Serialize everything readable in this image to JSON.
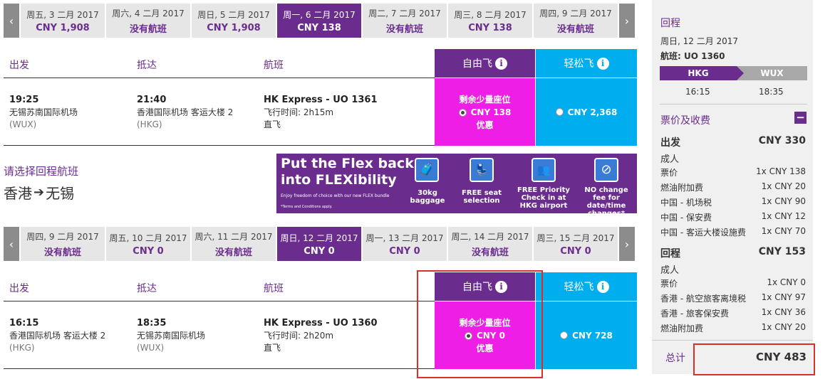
{
  "outbound_dates": [
    {
      "day": "周五, 3 二月 2017",
      "price": "CNY 1,908"
    },
    {
      "day": "周六, 4 二月 2017",
      "price": "没有航班"
    },
    {
      "day": "周日, 5 二月 2017",
      "price": "CNY 1,908"
    },
    {
      "day": "周一, 6 二月 2017",
      "price": "CNY 138"
    },
    {
      "day": "周二, 7 二月 2017",
      "price": "没有航班"
    },
    {
      "day": "周三, 8 二月 2017",
      "price": "CNY 138"
    },
    {
      "day": "周四, 9 二月 2017",
      "price": "没有航班"
    }
  ],
  "return_dates": [
    {
      "day": "周四, 9 二月 2017",
      "price": "没有航班"
    },
    {
      "day": "周五, 10 二月 2017",
      "price": "CNY 0"
    },
    {
      "day": "周六, 11 二月 2017",
      "price": "没有航班"
    },
    {
      "day": "周日, 12 二月 2017",
      "price": "CNY 0"
    },
    {
      "day": "周一, 13 二月 2017",
      "price": "CNY 0"
    },
    {
      "day": "周二, 14 二月 2017",
      "price": "没有航班"
    },
    {
      "day": "周三, 15 二月 2017",
      "price": "CNY 0"
    }
  ],
  "nav": {
    "prev": "‹",
    "next": "›"
  },
  "headers": {
    "depart": "出发",
    "arrive": "抵达",
    "flight": "航班",
    "fare1": "自由飞",
    "fare2": "轻松飞"
  },
  "outbound": {
    "dep_time": "19:25",
    "dep_airport": "无锡苏南国际机场",
    "dep_code": "(WUX)",
    "arr_time": "21:40",
    "arr_airport": "香港国际机场 客运大楼 2",
    "arr_code": "(HKG)",
    "flight": "HK Express - UO 1361",
    "duration": "飞行时间: 2h15m",
    "stops": "直飞",
    "fare1_note": "剩余少量座位",
    "fare1_price": "CNY 138",
    "fare1_tag": "优惠",
    "fare2_price": "CNY 2,368"
  },
  "return_prompt": {
    "title": "请选择回程航班",
    "from": "香港",
    "to": "无锡"
  },
  "banner": {
    "line1": "Put the Flex back",
    "line2": "into FLEXibility",
    "sub": "Enjoy freedom of choice with our new FLEX bundle",
    "terms": "*Terms and Conditions apply.",
    "items": [
      "30kg baggage",
      "FREE seat selection",
      "FREE Priority Check in at HKG airport",
      "NO change fee for date/time changes*"
    ]
  },
  "inbound": {
    "dep_time": "16:15",
    "dep_airport": "香港国际机场 客运大楼 2",
    "dep_code": "(HKG)",
    "arr_time": "18:35",
    "arr_airport": "无锡苏南国际机场",
    "arr_code": "(WUX)",
    "flight": "HK Express - UO 1360",
    "duration": "飞行时间: 2h20m",
    "stops": "直飞",
    "fare1_note": "剩余少量座位",
    "fare1_price": "CNY 0",
    "fare1_tag": "优惠",
    "fare2_price": "CNY 728"
  },
  "summary": {
    "title": "回程",
    "date": "周日, 12 二月 2017",
    "flight": "航班: UO 1360",
    "from": "HKG",
    "to": "WUX",
    "dep": "16:15",
    "arr": "18:35",
    "fees_title": "票价及收费",
    "collapse": "−",
    "out_label": "出发",
    "out_total": "CNY 330",
    "out_pax": "成人",
    "out_items": [
      [
        "票价",
        "1x CNY 138"
      ],
      [
        "燃油附加费",
        "1x CNY 20"
      ],
      [
        "中国 - 机场税",
        "1x CNY 90"
      ],
      [
        "中国 - 保安费",
        "1x CNY 12"
      ],
      [
        "中国 - 客运大楼设施费",
        "1x CNY 70"
      ]
    ],
    "ret_label": "回程",
    "ret_total": "CNY 153",
    "ret_pax": "成人",
    "ret_items": [
      [
        "票价",
        "1x CNY 0"
      ],
      [
        "香港 - 航空旅客离境税",
        "1x CNY 97"
      ],
      [
        "香港 - 旅客保安费",
        "1x CNY 36"
      ],
      [
        "燃油附加费",
        "1x CNY 20"
      ]
    ],
    "total_label": "总计",
    "total": "CNY 483"
  },
  "colors": {
    "purple": "#6b2d8d",
    "magenta": "#ee1ee6",
    "cyan": "#00aeef"
  }
}
